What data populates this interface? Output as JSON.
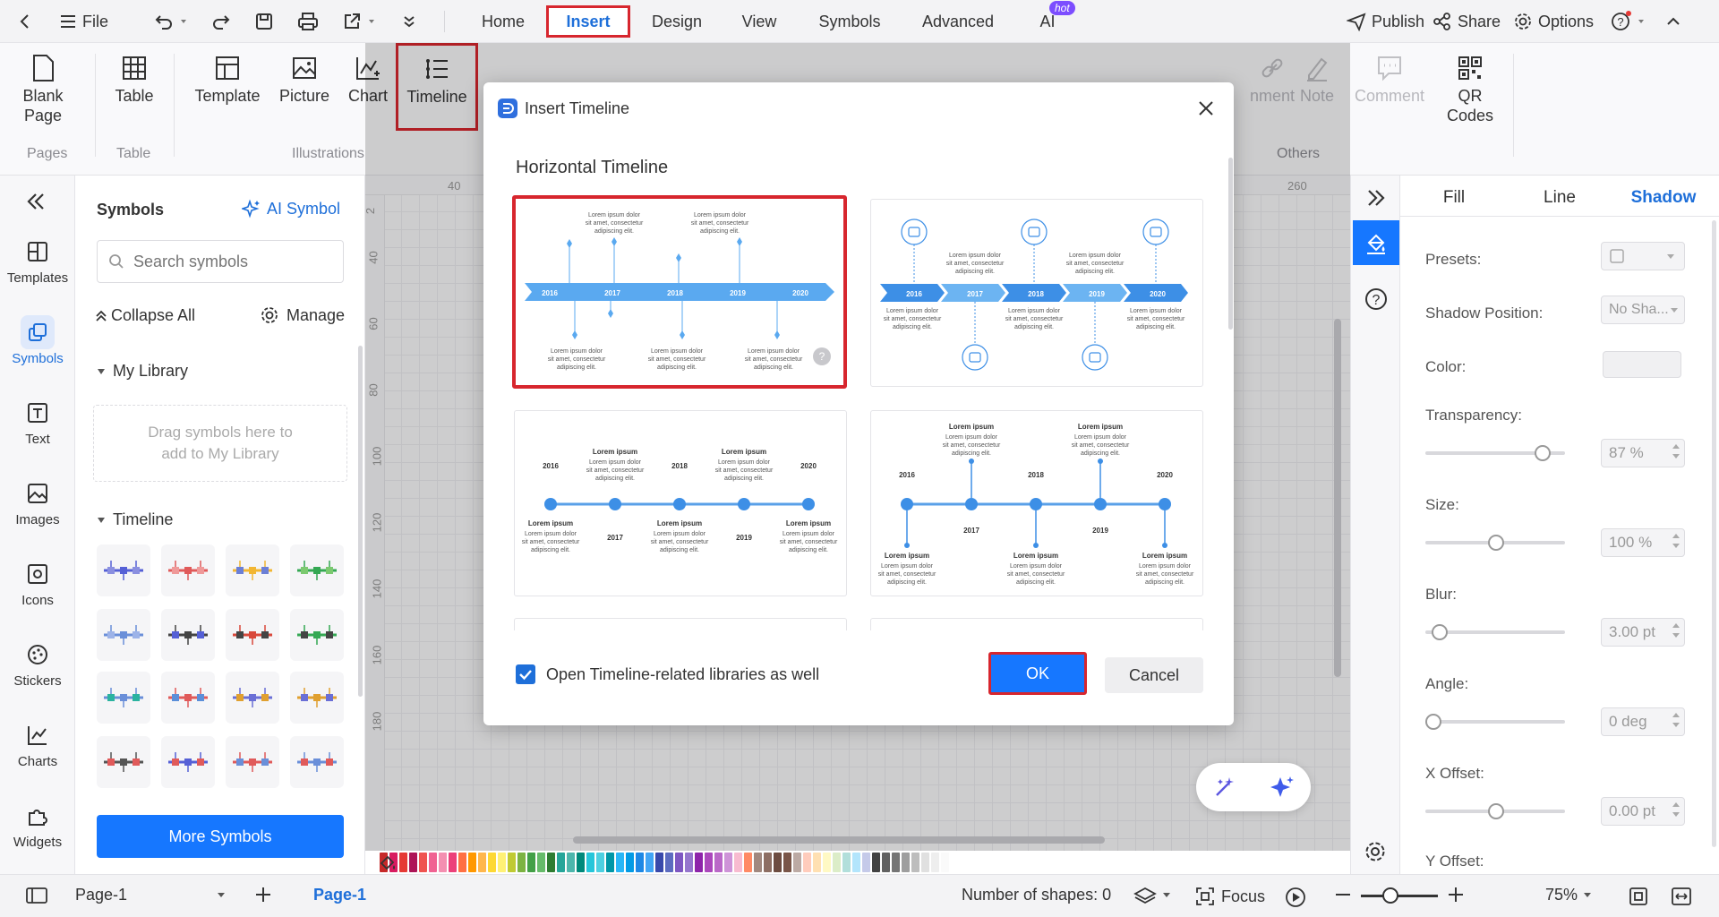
{
  "topbar": {
    "file_label": "File",
    "tabs": [
      {
        "label": "Home"
      },
      {
        "label": "Insert"
      },
      {
        "label": "Design"
      },
      {
        "label": "View"
      },
      {
        "label": "Symbols"
      },
      {
        "label": "Advanced"
      },
      {
        "label": "AI"
      }
    ],
    "hot_badge": "hot",
    "publish_label": "Publish",
    "share_label": "Share",
    "options_label": "Options"
  },
  "ribbon": {
    "blank_page_label": "Blank Page",
    "table_label": "Table",
    "template_label": "Template",
    "picture_label": "Picture",
    "chart_label": "Chart",
    "timeline_label": "Timeline",
    "comment_partial": "nment",
    "note_label": "Note",
    "comment_label": "Comment",
    "qr_label": "QR Codes",
    "groups": {
      "pages": "Pages",
      "table": "Table",
      "illustrations": "Illustrations",
      "others": "Others"
    }
  },
  "leftnav": {
    "items": [
      {
        "label": "Templates"
      },
      {
        "label": "Symbols"
      },
      {
        "label": "Text"
      },
      {
        "label": "Images"
      },
      {
        "label": "Icons"
      },
      {
        "label": "Stickers"
      },
      {
        "label": "Charts"
      },
      {
        "label": "Widgets"
      }
    ]
  },
  "symbols_panel": {
    "title": "Symbols",
    "ai_symbol_label": "AI Symbol",
    "search_placeholder": "Search symbols",
    "collapse_all": "Collapse All",
    "manage": "Manage",
    "my_library": "My Library",
    "drop_hint": "Drag symbols here to add to My Library",
    "timeline_section": "Timeline",
    "more_symbols": "More Symbols"
  },
  "ruler": {
    "top": [
      "40",
      "260"
    ],
    "left": [
      "2",
      "40",
      "60",
      "80",
      "100",
      "120",
      "140",
      "160",
      "180"
    ]
  },
  "dialog": {
    "title": "Insert Timeline",
    "section_title": "Horizontal Timeline",
    "checkbox_label": "Open Timeline-related libraries as well",
    "checkbox_checked": true,
    "ok_label": "OK",
    "cancel_label": "Cancel",
    "years": [
      "2016",
      "2017",
      "2018",
      "2019",
      "2020"
    ],
    "lorem_heading": "Lorem ipsum",
    "lorem_line1": "Lorem ipsum dolor",
    "lorem_line2": "sit amet, consectetur",
    "lorem_line3": "adipiscing elit."
  },
  "right_panel": {
    "tabs": [
      {
        "label": "Fill"
      },
      {
        "label": "Line"
      },
      {
        "label": "Shadow"
      }
    ],
    "presets_label": "Presets:",
    "shadow_position_label": "Shadow Position:",
    "shadow_position_value": "No Sha...",
    "color_label": "Color:",
    "transparency_label": "Transparency:",
    "transparency_value": "87 %",
    "transparency_level": 0.87,
    "size_label": "Size:",
    "size_value": "100 %",
    "size_level": 0.5,
    "blur_label": "Blur:",
    "blur_value": "3.00 pt",
    "blur_level": 0.05,
    "angle_label": "Angle:",
    "angle_value": "0 deg",
    "angle_level": 0.0,
    "x_offset_label": "X Offset:",
    "x_offset_value": "0.00 pt",
    "x_offset_level": 0.5,
    "y_offset_label": "Y Offset:"
  },
  "statusbar": {
    "page_select": "Page-1",
    "page_tab": "Page-1",
    "shape_count": "Number of shapes: 0",
    "focus_label": "Focus",
    "zoom": "75%"
  },
  "colors": {
    "accent": "#1e6fd9",
    "highlight_red": "#d7262e",
    "timeline_blue": "#5aa9f0"
  }
}
